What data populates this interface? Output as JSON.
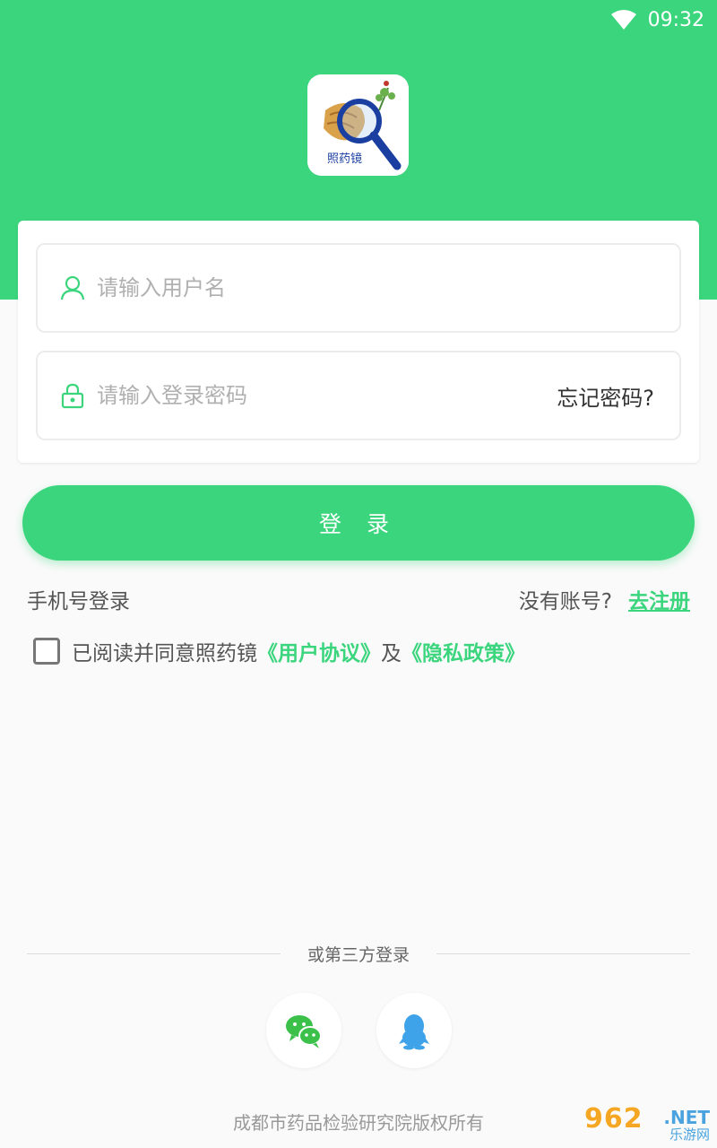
{
  "status_bar": {
    "time": "09:32"
  },
  "app": {
    "logo_text": "照药镜"
  },
  "colors": {
    "brand": "#3bd57d",
    "text": "#333333",
    "placeholder": "#b0b0b0",
    "link": "#3bd57d"
  },
  "form": {
    "username_placeholder": "请输入用户名",
    "password_placeholder": "请输入登录密码",
    "forgot_password": "忘记密码?"
  },
  "login_button": "登 录",
  "links": {
    "phone_login": "手机号登录",
    "no_account": "没有账号?",
    "register": "去注册"
  },
  "agreement": {
    "prefix": "已阅读并同意照药镜",
    "user_agreement": "《用户协议》",
    "conjunction": "及",
    "privacy_policy": "《隐私政策》"
  },
  "third_party": {
    "title": "或第三方登录",
    "icons": [
      "wechat-icon",
      "qq-icon"
    ]
  },
  "footer": {
    "copyright": "成都市药品检验研究院版权所有"
  },
  "watermark": {
    "number": "962",
    "domain": ".NET",
    "text": "乐游网"
  }
}
